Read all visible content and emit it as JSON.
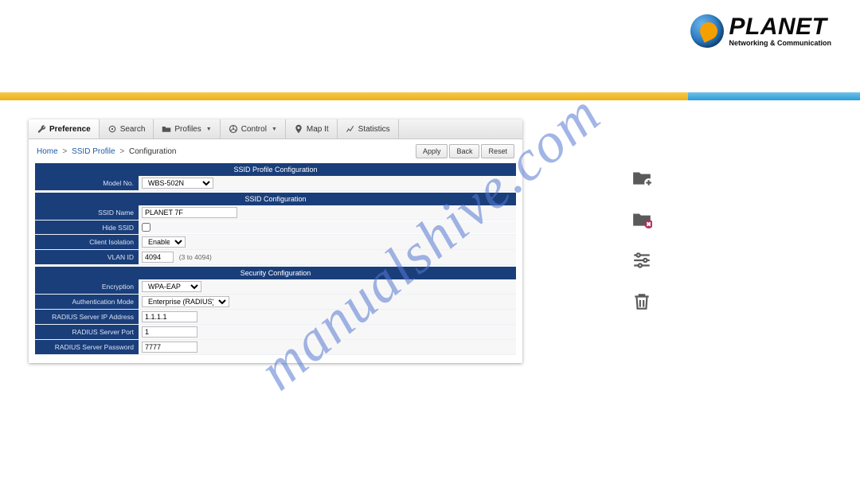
{
  "brand": {
    "name": "PLANET",
    "tagline": "Networking & Communication"
  },
  "tabs": {
    "preference": "Preference",
    "search": "Search",
    "profiles": "Profiles",
    "control": "Control",
    "mapit": "Map It",
    "statistics": "Statistics"
  },
  "breadcrumb": {
    "home": "Home",
    "mid": "SSID Profile",
    "current": "Configuration"
  },
  "buttons": {
    "apply": "Apply",
    "back": "Back",
    "reset": "Reset"
  },
  "sections": {
    "profile": "SSID Profile Configuration",
    "ssid": "SSID Configuration",
    "security": "Security Configuration"
  },
  "labels": {
    "model": "Model No.",
    "ssid_name": "SSID Name",
    "hide_ssid": "Hide SSID",
    "client_isolation": "Client Isolation",
    "vlan_id": "VLAN ID",
    "encryption": "Encryption",
    "auth_mode": "Authentication Mode",
    "radius_ip": "RADIUS Server IP Address",
    "radius_port": "RADIUS Server Port",
    "radius_pass": "RADIUS Server Password"
  },
  "values": {
    "model": "WBS-502N",
    "ssid_name": "PLANET 7F",
    "client_isolation": "Enable",
    "vlan_id": "4094",
    "vlan_hint": "(3 to 4094)",
    "encryption": "WPA-EAP",
    "auth_mode": "Enterprise (RADIUS)",
    "radius_ip": "1.1.1.1",
    "radius_port": "1",
    "radius_pass": "7777"
  },
  "watermark": "manualshive.com"
}
